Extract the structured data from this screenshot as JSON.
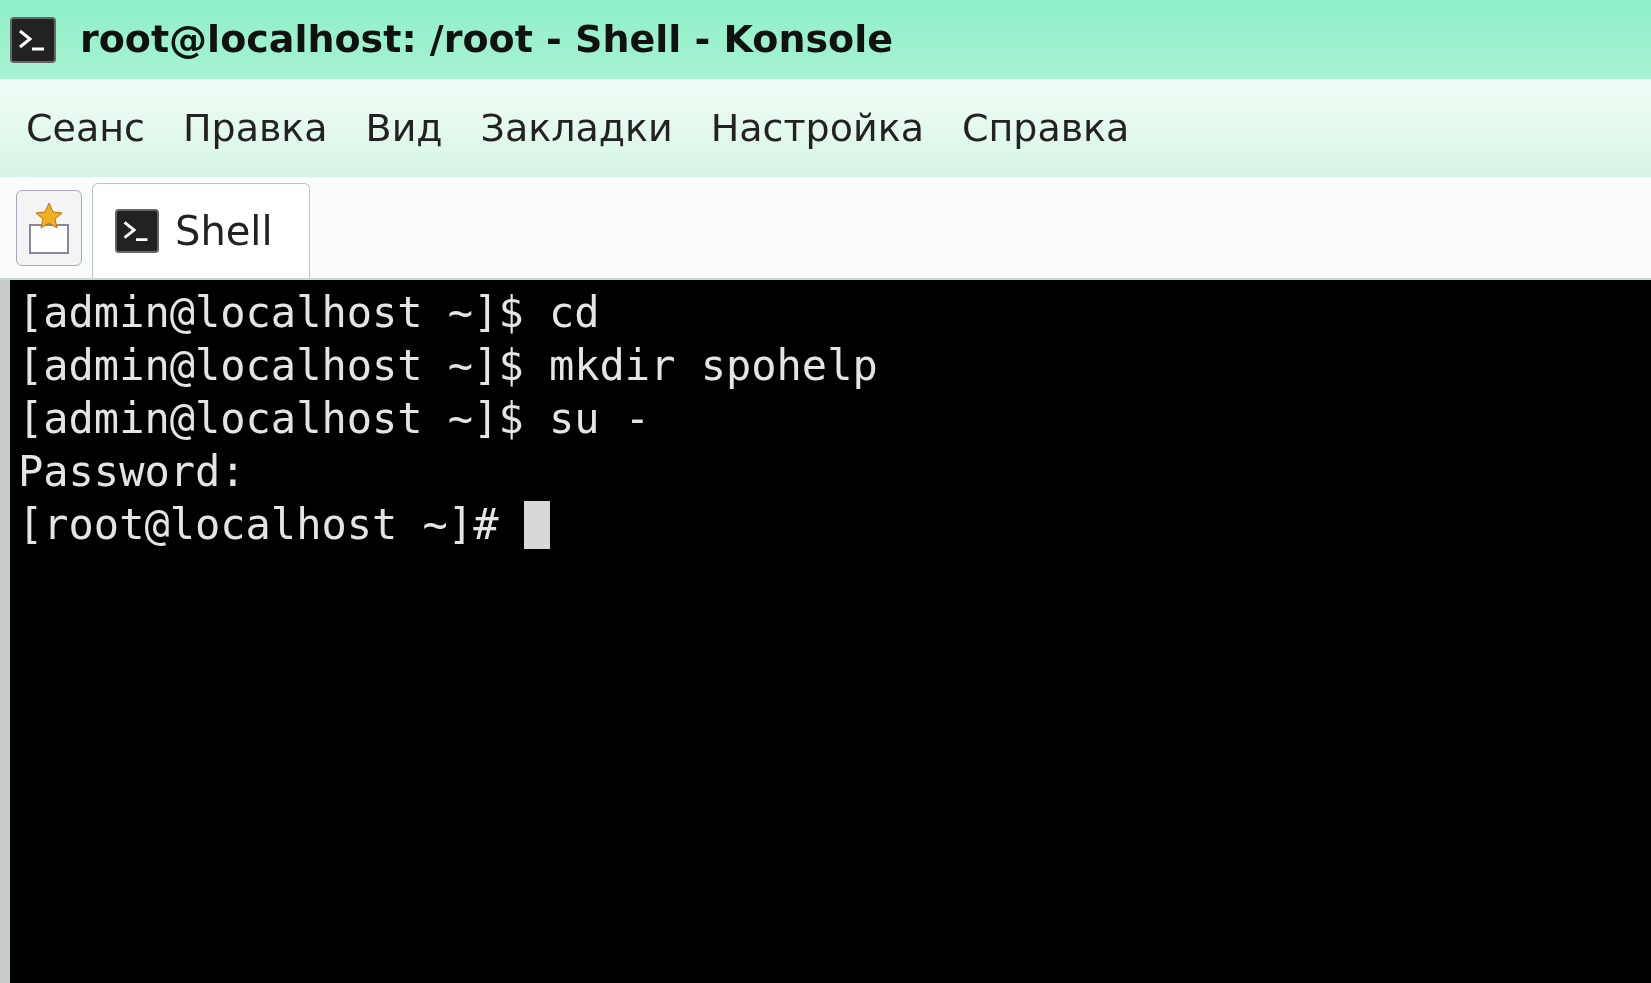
{
  "window": {
    "title": "root@localhost: /root - Shell - Konsole"
  },
  "menu": [
    "Сеанс",
    "Правка",
    "Вид",
    "Закладки",
    "Настройка",
    "Справка"
  ],
  "tabs": [
    {
      "label": "Shell",
      "selected": true
    }
  ],
  "terminal": {
    "lines": [
      "[admin@localhost ~]$ cd",
      "[admin@localhost ~]$ mkdir spohelp",
      "[admin@localhost ~]$ su -",
      "Password:",
      "[root@localhost ~]# "
    ]
  }
}
